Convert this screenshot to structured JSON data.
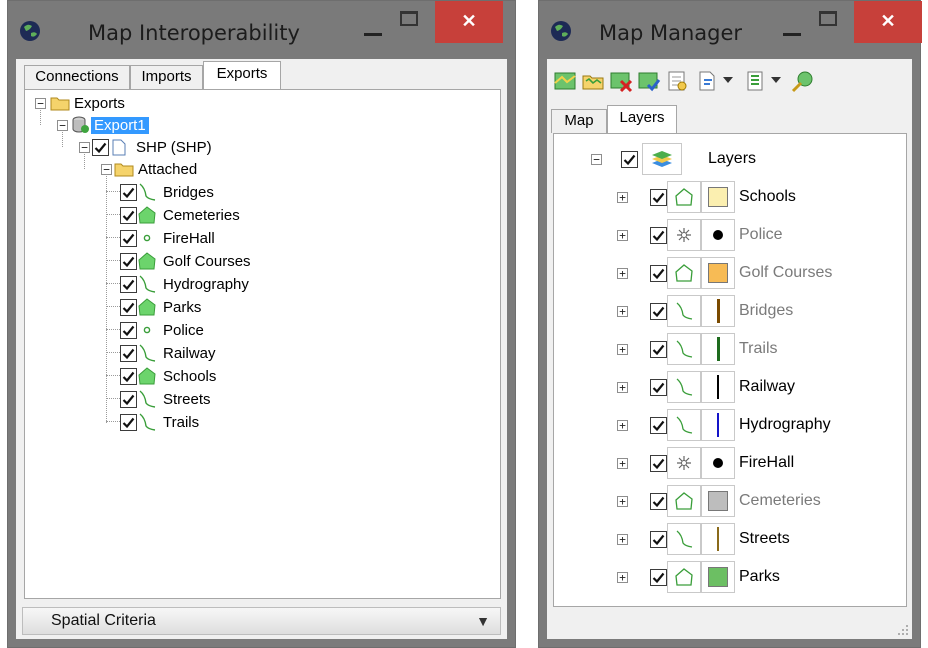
{
  "left_window": {
    "title": "Map Interoperability",
    "close_glyph": "✕",
    "tabs": [
      "Connections",
      "Imports",
      "Exports"
    ],
    "active_tab": "Exports",
    "tree": {
      "root": "Exports",
      "export": "Export1",
      "format": "SHP (SHP)",
      "attached": "Attached",
      "layers": [
        {
          "name": "Bridges",
          "icon": "line-icon"
        },
        {
          "name": "Cemeteries",
          "icon": "polygon-icon"
        },
        {
          "name": "FireHall",
          "icon": "point-icon"
        },
        {
          "name": "Golf Courses",
          "icon": "polygon-icon"
        },
        {
          "name": "Hydrography",
          "icon": "line-icon"
        },
        {
          "name": "Parks",
          "icon": "polygon-icon"
        },
        {
          "name": "Police",
          "icon": "point-icon"
        },
        {
          "name": "Railway",
          "icon": "line-icon"
        },
        {
          "name": "Schools",
          "icon": "polygon-icon"
        },
        {
          "name": "Streets",
          "icon": "line-icon"
        },
        {
          "name": "Trails",
          "icon": "line-icon"
        }
      ]
    },
    "spatial_criteria": "Spatial Criteria"
  },
  "right_window": {
    "title": "Map Manager",
    "close_glyph": "✕",
    "tabs": [
      "Map",
      "Layers"
    ],
    "active_tab": "Layers",
    "root_label": "Layers",
    "layers": [
      {
        "name": "Schools",
        "type": "polygon",
        "color": "#fbefb0",
        "dimmed": false
      },
      {
        "name": "Police",
        "type": "point",
        "color": "#000000",
        "dimmed": true
      },
      {
        "name": "Golf Courses",
        "type": "polygon",
        "color": "#f7bb55",
        "dimmed": true
      },
      {
        "name": "Bridges",
        "type": "line",
        "color": "#7a4a00",
        "dimmed": true
      },
      {
        "name": "Trails",
        "type": "line",
        "color": "#1e6b1e",
        "dimmed": true
      },
      {
        "name": "Railway",
        "type": "line",
        "color": "#000000",
        "dimmed": false
      },
      {
        "name": "Hydrography",
        "type": "line",
        "color": "#1414c8",
        "dimmed": false
      },
      {
        "name": "FireHall",
        "type": "point",
        "color": "#000000",
        "dimmed": false
      },
      {
        "name": "Cemeteries",
        "type": "polygon",
        "color": "#bdbdbd",
        "dimmed": true
      },
      {
        "name": "Streets",
        "type": "line",
        "color": "#8a6a1a",
        "dimmed": false
      },
      {
        "name": "Parks",
        "type": "polygon",
        "color": "#6cbf63",
        "dimmed": false
      }
    ]
  },
  "colors": {
    "titlebar": "#7a7a7a",
    "close": "#c7403a",
    "selection": "#3399ff",
    "layer_shape_green": "#6cd46c",
    "dimmed_text": "#7a7a7a"
  }
}
